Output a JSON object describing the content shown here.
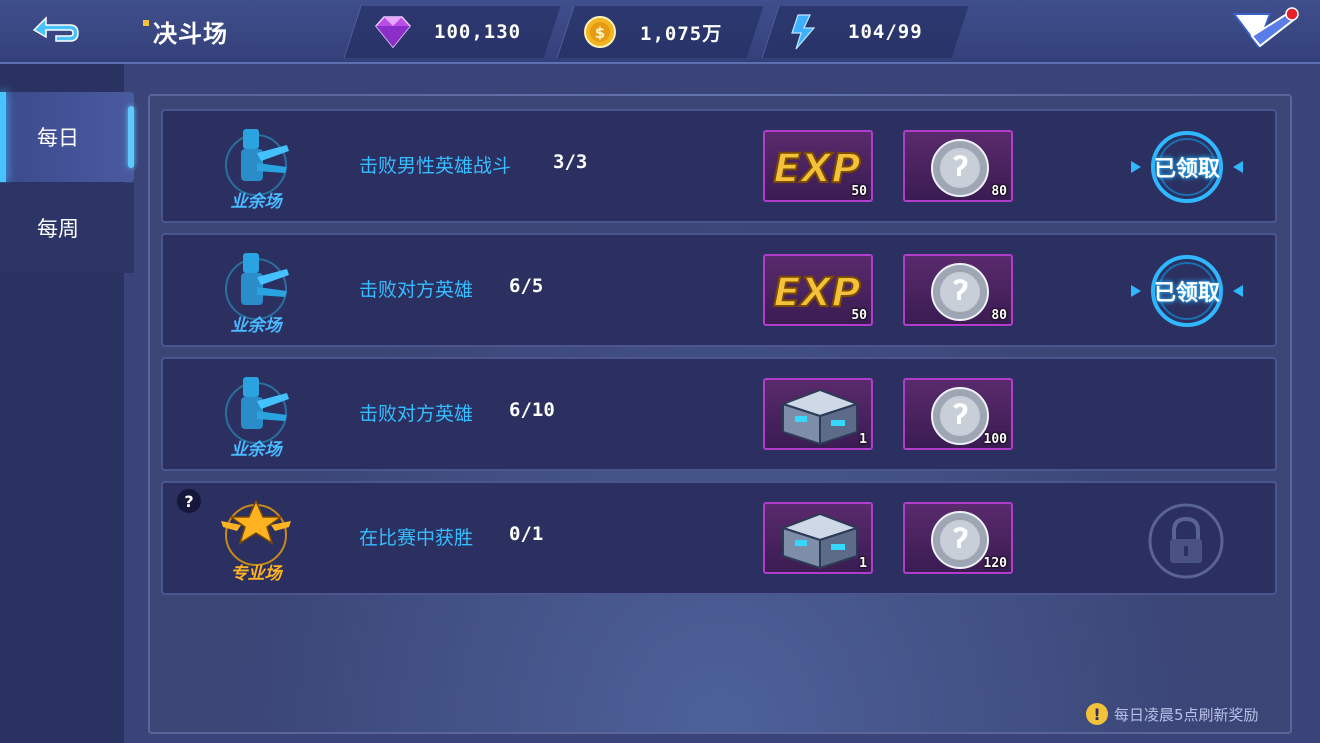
{
  "header": {
    "title": "决斗场",
    "resources": [
      {
        "icon": "diamond-icon",
        "value": "100,130"
      },
      {
        "icon": "gold-coin-icon",
        "value": "1,075万"
      },
      {
        "icon": "energy-bolt-icon",
        "value": "104/99"
      }
    ],
    "menu_has_notification": true
  },
  "sidebar": {
    "tabs": [
      {
        "label": "每日",
        "selected": true
      },
      {
        "label": "每周",
        "selected": false
      }
    ]
  },
  "tasks": [
    {
      "badge": "业余场",
      "badge_icon": "amateur-arena-icon",
      "text": "击败男性英雄战斗",
      "progress": "3/3",
      "rewards": [
        {
          "icon": "exp-reward-icon",
          "label": "EXP",
          "count": "50"
        },
        {
          "icon": "silver-coin-icon",
          "count": "80"
        }
      ],
      "status": "已领取"
    },
    {
      "badge": "业余场",
      "badge_icon": "amateur-arena-icon",
      "text": "击败对方英雄",
      "progress": "6/5",
      "rewards": [
        {
          "icon": "exp-reward-icon",
          "label": "EXP",
          "count": "50"
        },
        {
          "icon": "silver-coin-icon",
          "count": "80"
        }
      ],
      "status": "已领取"
    },
    {
      "badge": "业余场",
      "badge_icon": "amateur-arena-icon",
      "text": "击败对方英雄",
      "progress": "6/10",
      "rewards": [
        {
          "icon": "treasure-chest-icon",
          "count": "1"
        },
        {
          "icon": "silver-coin-icon",
          "count": "100"
        }
      ],
      "status": ""
    },
    {
      "badge": "专业场",
      "badge_icon": "pro-arena-icon",
      "text": "在比赛中获胜",
      "progress": "0/1",
      "help": "?",
      "rewards": [
        {
          "icon": "treasure-chest-icon",
          "count": "1"
        },
        {
          "icon": "silver-coin-icon",
          "count": "120"
        }
      ],
      "status_icon": "lock-icon"
    }
  ],
  "footer": {
    "icon": "!",
    "note": "每日凌晨5点刷新奖励"
  },
  "colors": {
    "task_text": "#37bcff",
    "reward_border": "#b03ecb",
    "accent_gold": "#f3c23a"
  }
}
